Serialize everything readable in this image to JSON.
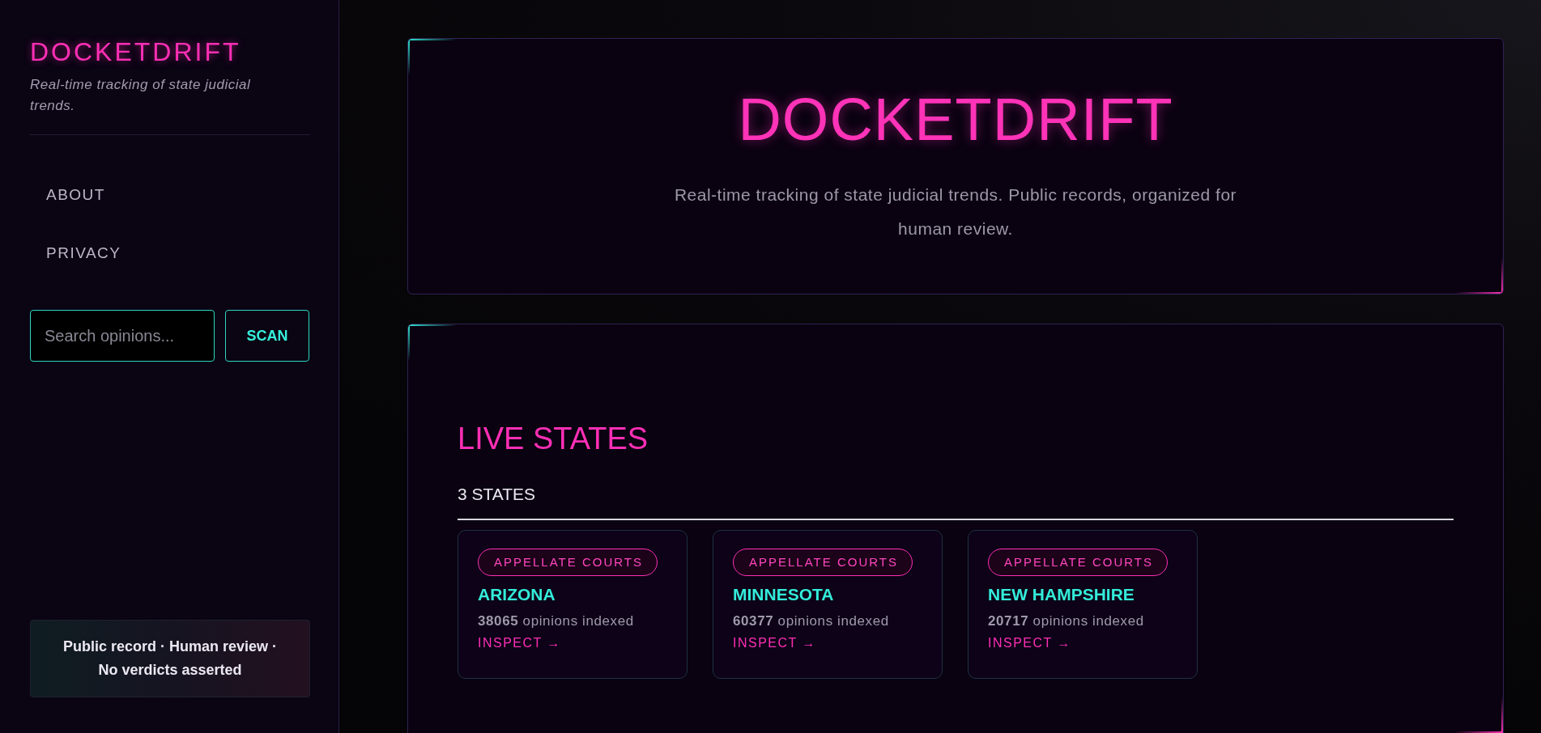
{
  "sidebar": {
    "brand": "DOCKETDRIFT",
    "tagline": "Real-time tracking of state judicial trends.",
    "nav": [
      {
        "label": "ABOUT"
      },
      {
        "label": "PRIVACY"
      }
    ],
    "search": {
      "placeholder": "Search opinions...",
      "button": "SCAN"
    },
    "footer_note": "Public record · Human review · No verdicts asserted"
  },
  "hero": {
    "title": "DOCKETDRIFT",
    "subtitle": "Real-time tracking of state judicial trends. Public records, organized for human review."
  },
  "live_states": {
    "heading": "LIVE STATES",
    "count": "3 STATES",
    "states": [
      {
        "tag": "APPELLATE COURTS",
        "name": "ARIZONA",
        "opinions": "**38065** opinions indexed",
        "link": "INSPECT →"
      },
      {
        "tag": "APPELLATE COURTS",
        "name": "MINNESOTA",
        "opinions": "**60377** opinions indexed",
        "link": "INSPECT →"
      },
      {
        "tag": "APPELLATE COURTS",
        "name": "NEW HAMPSHIRE",
        "opinions": "**20717** opinions indexed",
        "link": "INSPECT →"
      }
    ]
  }
}
